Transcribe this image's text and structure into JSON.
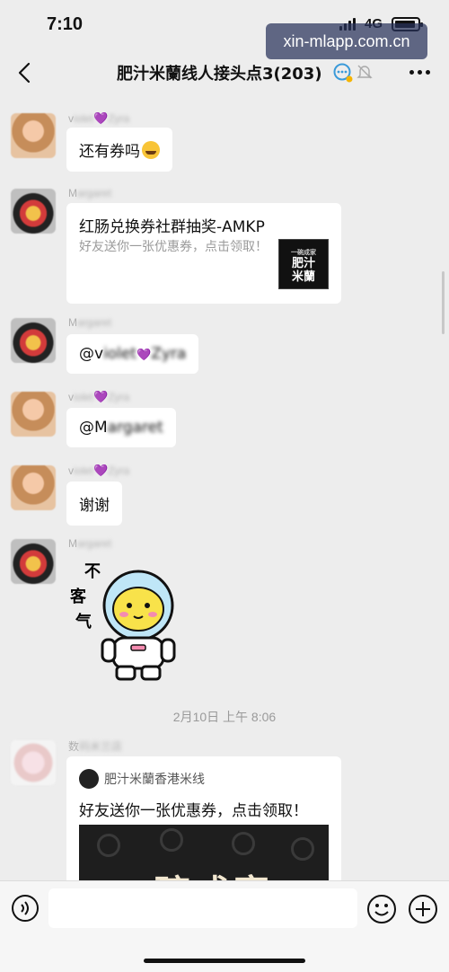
{
  "status_bar": {
    "time": "7:10",
    "network": "4G"
  },
  "watermark": "xin-mlapp.com.cn",
  "header": {
    "title": "肥汁米蘭线人接头点3(203)"
  },
  "messages": [
    {
      "sender_prefix": "v",
      "sender_blur": "iolet",
      "sender_suffix": "Zyra",
      "text": "还有券吗"
    },
    {
      "sender_prefix": "M",
      "sender_blur": "argaret",
      "card_title": "红肠兑换券社群抽奖-AMKP",
      "card_desc": "好友送你一张优惠券，点击领取！",
      "thumb_text": "肥汁\n米蘭",
      "thumb_small": "一碗成家"
    },
    {
      "sender_prefix": "M",
      "sender_blur": "argaret",
      "text_prefix": "@v",
      "text_blur": "iolet",
      "text_suffix": "Zyra"
    },
    {
      "sender_prefix": "v",
      "sender_blur": "iolet",
      "sender_suffix": "Zyra",
      "text_prefix": "@M",
      "text_blur": "argaret"
    },
    {
      "sender_prefix": "v",
      "sender_blur": "iolet",
      "sender_suffix": "Zyra",
      "text": "谢谢"
    },
    {
      "sender_prefix": "M",
      "sender_blur": "argaret",
      "sticker_text": [
        "不",
        "客",
        "气"
      ]
    },
    {
      "sender_prefix": "数",
      "sender_blur": "码米兰店",
      "mini_source": "肥汁米蘭香港米线",
      "mini_title": "好友送你一张优惠券，点击领取！",
      "mini_image_text": "一碗成宴"
    }
  ],
  "time_divider": "2月10日 上午 8:06",
  "input": {
    "value": ""
  },
  "icons": [
    "back-icon",
    "chat-bubble-icon",
    "mute-icon",
    "more-icon",
    "voice-icon",
    "emoji-icon",
    "plus-icon"
  ]
}
